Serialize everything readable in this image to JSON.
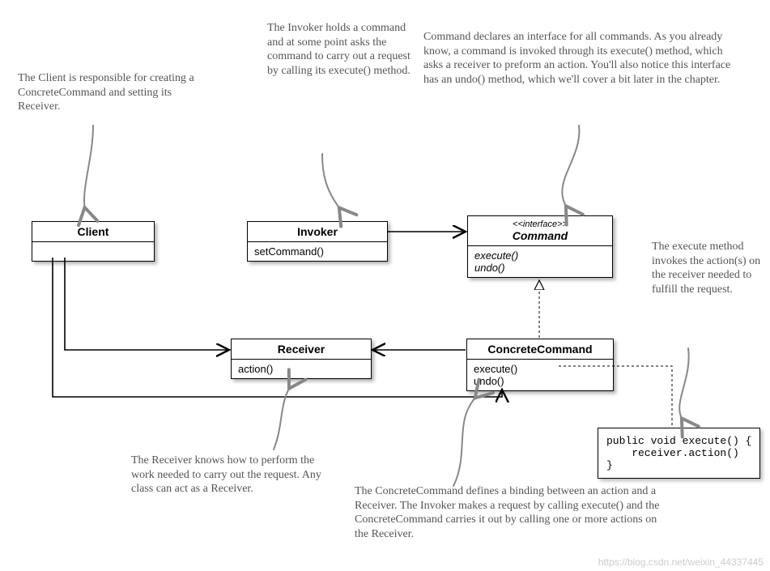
{
  "boxes": {
    "client": {
      "title": "Client",
      "sec1": "",
      "sec2": ""
    },
    "invoker": {
      "title": "Invoker",
      "sec1": "setCommand()"
    },
    "command": {
      "stereo": "<<interface>>",
      "title": "Command",
      "sec1_a": "execute()",
      "sec1_b": "undo()"
    },
    "receiver": {
      "title": "Receiver",
      "sec1": "action()"
    },
    "concrete": {
      "title": "ConcreteCommand",
      "sec1_a": "execute()",
      "sec1_b": "undo()"
    }
  },
  "notes": {
    "client": "The Client is responsible for creating a ConcreteCommand and setting its Receiver.",
    "invoker": "The Invoker holds a command and at some point asks the command to carry out a request by calling its execute() method.",
    "command": "Command declares an interface for all commands.  As you already know, a command is invoked through its execute() method, which asks a receiver to preform an action.  You'll also notice this interface has an undo() method, which we'll cover a bit later in the chapter.",
    "execute": "The execute method invokes the action(s) on the receiver needed to fulfill the request.",
    "receiver": "The Receiver knows how to perform the work needed to carry out the request.  Any class can act as a Receiver.",
    "concrete": "The ConcreteCommand defines a binding between an action and a Receiver.  The Invoker makes a request by calling execute() and the ConcreteCommand carries it out by calling one or more actions on the Receiver."
  },
  "code": "public void execute() {\n    receiver.action()\n}",
  "credit": "https://blog.csdn.net/weixin_44337445"
}
